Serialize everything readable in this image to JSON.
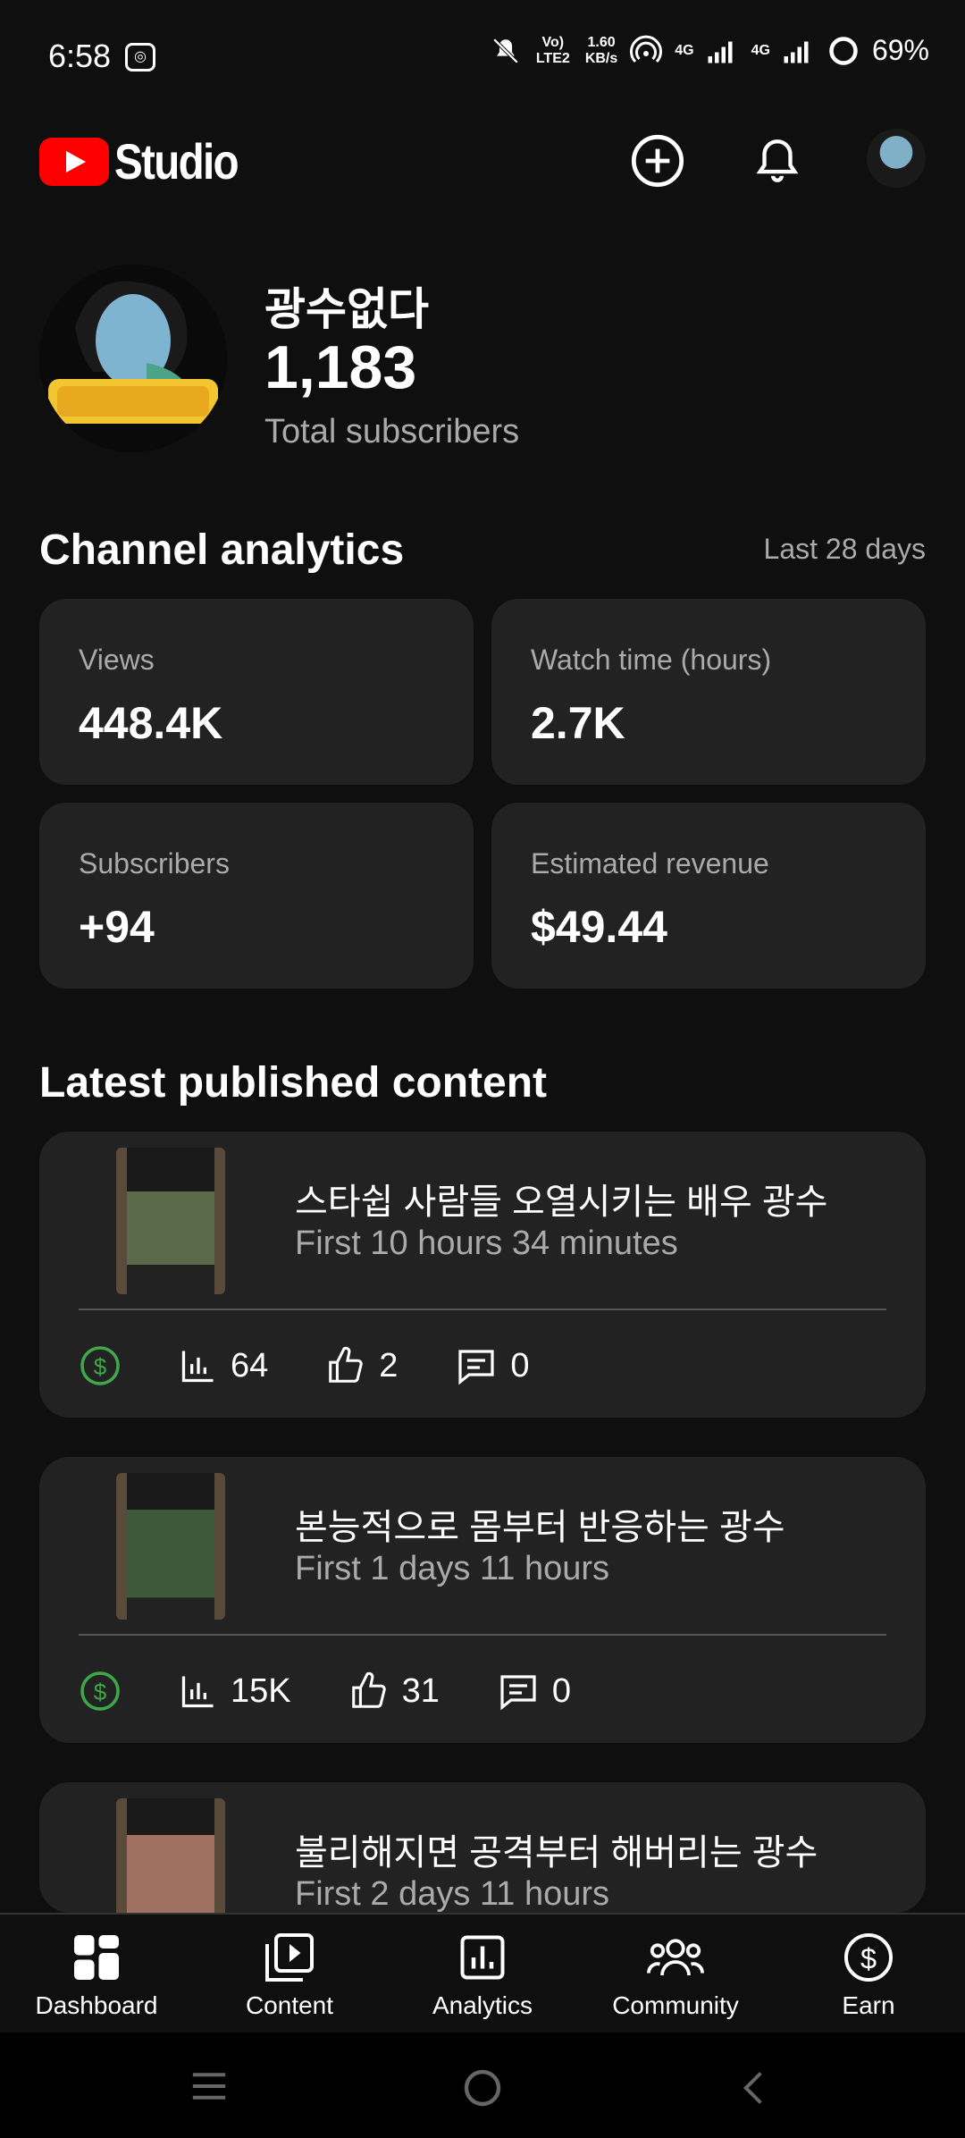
{
  "status_bar": {
    "time": "6:58",
    "network_label": "Vo) LTE2",
    "speed_value": "1.60",
    "speed_unit": "KB/s",
    "signal_1": "4G",
    "signal_2": "4G",
    "battery": "69%"
  },
  "header": {
    "logo_text": "Studio"
  },
  "channel": {
    "name": "광수없다",
    "subscriber_count": "1,183",
    "subscriber_label": "Total subscribers"
  },
  "analytics": {
    "title": "Channel analytics",
    "period": "Last 28 days",
    "cards": [
      {
        "label": "Views",
        "value": "448.4K"
      },
      {
        "label": "Watch time (hours)",
        "value": "2.7K"
      },
      {
        "label": "Subscribers",
        "value": "+94"
      },
      {
        "label": "Estimated revenue",
        "value": "$49.44"
      }
    ]
  },
  "latest": {
    "title": "Latest published content",
    "items": [
      {
        "title": "스타쉽 사람들 오열시키는 배우 광수",
        "subtitle": "First 10 hours 34 minutes",
        "views": "64",
        "likes": "2",
        "comments": "0"
      },
      {
        "title": "본능적으로 몸부터 반응하는 광수",
        "subtitle": "First 1 days 11 hours",
        "views": "15K",
        "likes": "31",
        "comments": "0"
      },
      {
        "title": "불리해지면 공격부터 해버리는 광수",
        "subtitle": "First 2 days 11 hours",
        "views": "",
        "likes": "",
        "comments": ""
      }
    ]
  },
  "nav": {
    "items": [
      {
        "label": "Dashboard",
        "icon": "dashboard-icon"
      },
      {
        "label": "Content",
        "icon": "content-icon"
      },
      {
        "label": "Analytics",
        "icon": "analytics-icon"
      },
      {
        "label": "Community",
        "icon": "community-icon"
      },
      {
        "label": "Earn",
        "icon": "earn-icon"
      }
    ]
  },
  "colors": {
    "background": "#0f0f0f",
    "card": "#222222",
    "brand_red": "#ff0000",
    "monetized_green": "#3ea74a",
    "muted_text": "#aaaaaa"
  }
}
